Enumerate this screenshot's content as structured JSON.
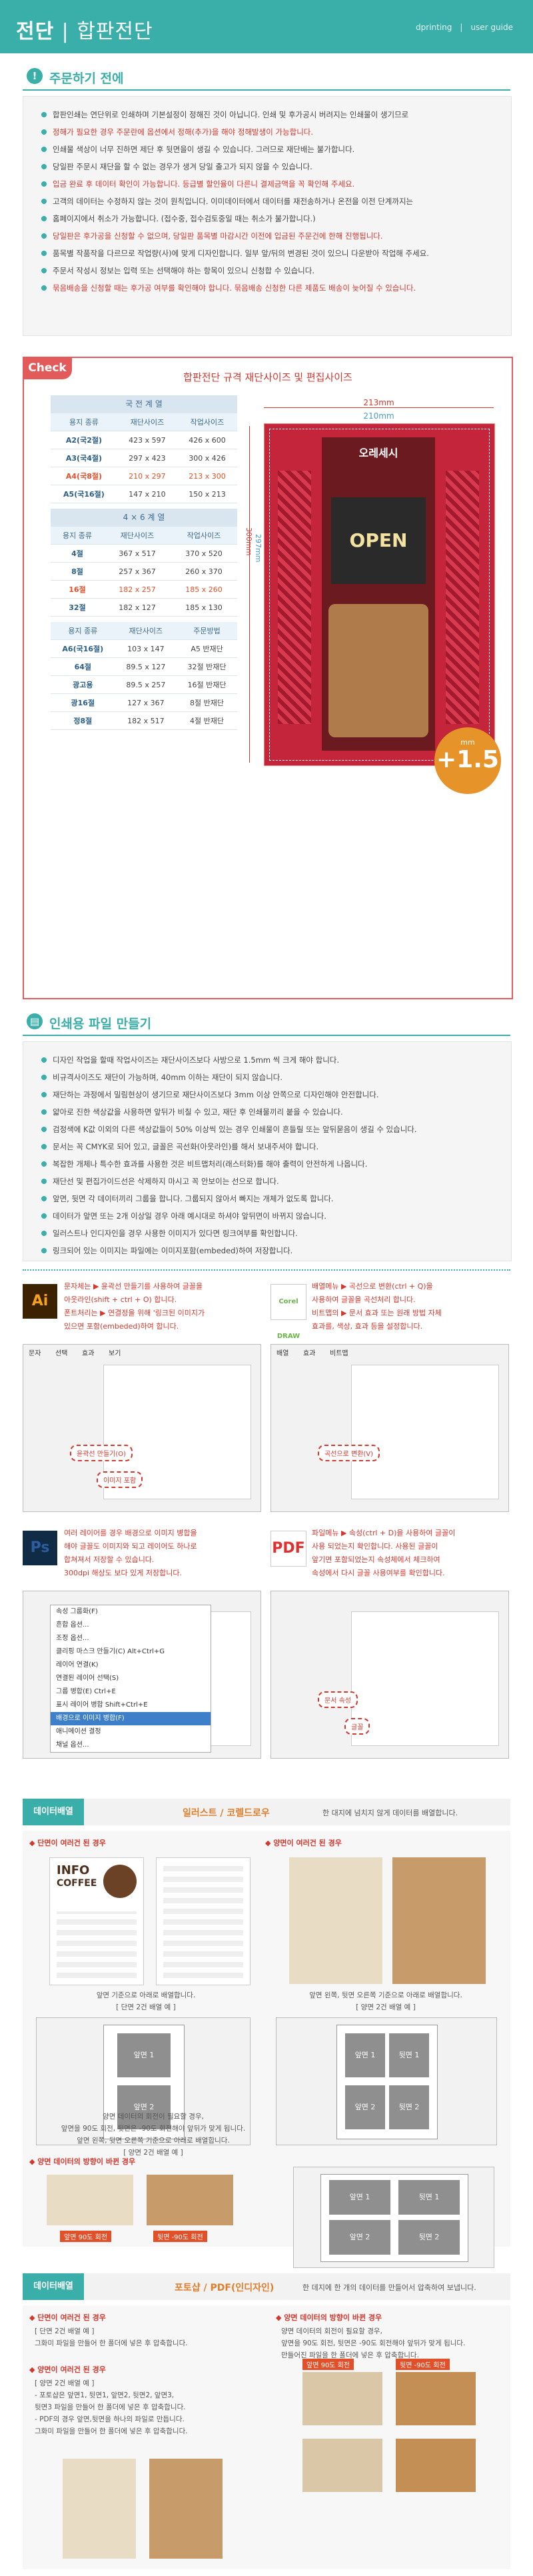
{
  "header": {
    "title_main": "전단",
    "title_sep": "|",
    "title_sub": "합판전단",
    "nav": [
      "dprinting",
      "user guide"
    ]
  },
  "section1": {
    "title": "주문하기 전에",
    "items": [
      {
        "text": "합판인쇄는 연단위로 인쇄하며 기본설정이 정해진 것이 아닙니다. 인쇄 및 후가공시 버려지는 인쇄물이 생기므로",
        "red": false
      },
      {
        "text": "정해가 필요한 경우 주문란에 옵션에서 정해(추가)을 해야 정해발생이 가능합니다.",
        "red": true
      },
      {
        "text": "인쇄물 색상이 너무 진하면 제단 후 뒷면을이 생길 수 있습니다. 그러므로 재단배는 불가합니다.",
        "red": false
      },
      {
        "text": "당일판 주문시 재단을 할 수 없는 경우가 생겨 당일 출고가 되지 않을 수 있습니다.",
        "red": false
      },
      {
        "text": "입금 완료 후 데이터 확인이 가능합니다. 등급별 할인율이 다른니 결제금액을 꼭 확인해 주세요.",
        "red": true
      },
      {
        "text": "고객의 데이터는 수정하지 않는 것이 원칙입니다. 이미데이터에서 데이터를 재전송하거나 온전을 이전 단계까지는",
        "red": false
      },
      {
        "text": "홈페이지에서 취소가 가능합니다. (접수중, 접수검토중일 때는 취소가 불가합니다.)",
        "red": false
      },
      {
        "text": "당일판은 후가공을 신청할 수 없으며, 당일판 품목별 마감시간 이전에 입금된 주문건에 한해 진행됩니다.",
        "red": true
      },
      {
        "text": "품목별 작품작을 다르므로 작업량(사)에 맞게 디자인합니다. 일부 앞/뒤의 변경된 것이 있으니 다운받아 작업해 주세요.",
        "red": false
      },
      {
        "text": "주문서 작성시 정보는 입력 또는 선택해야 하는 항목이 있으니 신청합 수 있습니다.",
        "red": false
      },
      {
        "text": "묶음배송을 신청할 때는 후가공 여부를 확인해야 합니다. 묶음배송 신청한 다른 제품도 배송이 늦어질 수 있습니다.",
        "red": true
      }
    ]
  },
  "section2": {
    "tab": "Check",
    "title": "합판전단 규격 재단사이즈 및 편집사이즈",
    "tables": [
      {
        "caption": "국 전 계 열",
        "headers": [
          "용지 종류",
          "재단사이즈",
          "작업사이즈"
        ],
        "highlight": 2,
        "rows": [
          [
            "A2(국2절)",
            "423 x 597",
            "426 x 600"
          ],
          [
            "A3(국4절)",
            "297 x 423",
            "300 x 426"
          ],
          [
            "A4(국8절)",
            "210 x 297",
            "213 x 300"
          ],
          [
            "A5(국16절)",
            "147 x 210",
            "150 x 213"
          ]
        ]
      },
      {
        "caption": "4 × 6 계 열",
        "headers": [
          "용지 종류",
          "재단사이즈",
          "작업사이즈"
        ],
        "highlight": 2,
        "rows": [
          [
            "4절",
            "367 x 517",
            "370 x 520"
          ],
          [
            "8절",
            "257 x 367",
            "260 x 370"
          ],
          [
            "16절",
            "182 x 257",
            "185 x 260"
          ],
          [
            "32절",
            "182 x 127",
            "185 x 130"
          ]
        ]
      },
      {
        "caption": "",
        "headers": [
          "용지 종류",
          "재단사이즈",
          "주문방법"
        ],
        "highlight": -1,
        "rows": [
          [
            "A6(국16절)",
            "103 x 147",
            "A5 반재단"
          ],
          [
            "64절",
            "89.5 x 127",
            "32절 반재단"
          ],
          [
            "광고용",
            "89.5 x 257",
            "16절 반재단"
          ],
          [
            "광16절",
            "127 x 367",
            "8절 반재단"
          ],
          [
            "정8절",
            "182 x 517",
            "4절 반재단"
          ]
        ]
      }
    ],
    "diagram": {
      "outer_w": "213mm",
      "inner_w": "210mm",
      "outer_h": "300mm",
      "inner_h": "297mm",
      "bleed_label": "+1.5",
      "bleed_unit": "mm",
      "brand": "오레세시",
      "open": "OPEN"
    }
  },
  "section3": {
    "title": "인쇄용 파일 만들기",
    "items": [
      {
        "text": "디자인 작업을 할때 작업사이즈는 재단사이즈보다 사방으로 1.5mm 씩 크게 해야 합니다.",
        "red": false
      },
      {
        "text": "비규격사이즈도 재단이 가능하며, 40mm 이하는 재단이 되지 않습니다.",
        "red": false
      },
      {
        "text": "재단하는 과정에서 밀림현상이 생기므로 재단사이즈보다 3mm 이상 안쪽으로 디자인해야 안전합니다.",
        "red": false
      },
      {
        "text": "얇아로 진한 색상값을 사용하면 앞뒤가 비칠 수 있고, 재단 후 인쇄물끼리 붙을 수 있습니다.",
        "red": false
      },
      {
        "text": "검정색에 K값 이외의 다른 색상값들이 50% 이상씩 있는 경우 인쇄물이 흔들릴 또는 앞뒤묻음이 생길 수 있습니다.",
        "red": false
      },
      {
        "text": "문서는 꼭 CMYK로 되어 있고, 글꼴은 곡선화(아웃라인)를 해서 보내주셔야 합니다.",
        "red": false
      },
      {
        "text": "복잡한 개체나 특수한 효과를 사용한 것은 비트맵처리(래스터화)를 해야 출력이 안전하게 나옵니다.",
        "red": false
      },
      {
        "text": "재단선 및 편집가이드선은 삭제하지 마시고 꼭 안보이는 선으로 합니다.",
        "red": false
      },
      {
        "text": "앞면, 뒷면 각 데이터끼리 그룹을 합니다. 그룹되지 않아서 빠지는 개체가 없도록 합니다.",
        "red": false
      },
      {
        "text": "데이터가 앞면 또는 2개 이상일 경우 아래 예시대로 하셔야 앞뒤면이 바뀌지 않습니다.",
        "red": false
      },
      {
        "text": "일러스트나 인디자인을 경우 사용한 이미지가 있다면 링크여부를 확인합니다.",
        "red": false
      },
      {
        "text": "링크되어 있는 이미지는 파일에는 이미지포함(embeded)하여 저장합니다.",
        "red": false
      }
    ]
  },
  "apps": [
    {
      "icon": "Ai",
      "notes": [
        "문자체는 ▶ 윤곽선 만들기를 사용하여 글꼴을",
        "아웃라인(shift + ctrl + O) 합니다.",
        "폰트처리는 ▶ 연결정을 위해 '링크된 이미지가",
        "있으면 포함(embeded)하여 합니다."
      ],
      "callouts": [
        "윤곽선 만들기(O)",
        "이미지 포함"
      ],
      "menu": [
        "문자",
        "선택",
        "효과",
        "보기"
      ]
    },
    {
      "icon": "Corel DRAW",
      "notes": [
        "배열메뉴 ▶ 곡선으로 변환(ctrl + Q)을",
        "사용하여 글꼴을 곡선처리 합니다.",
        "비트맵의 ▶ 문서 효과 또는 원래 방법 자체",
        "효과를, 색상, 효과 등을 설정합니다."
      ],
      "callouts": [
        "곡선으로 변환(V)"
      ],
      "menu": [
        "배열",
        "효과",
        "비트맵"
      ]
    },
    {
      "icon": "Ps",
      "notes": [
        "여러 레이어를 경우 배경으로 이미지 병합을",
        "해야 글꼴도 이미지와 되고 레이어도 하나로",
        "합쳐져서 저장할 수 있습니다.",
        "300dpi 해상도 보다 있게 저장합니다."
      ],
      "menu_items": [
        "속성 그룹화(F)",
        "흔합 옵션...",
        "조정 옵션...",
        "클리핑 마스크 만들기(C)   Alt+Ctrl+G",
        "레이어 연결(K)",
        "연결된 레이어 선택(S)",
        "그룹 병합(E)   Ctrl+E",
        "표시 레이어 병합   Shift+Ctrl+E",
        "배경으로 이미지 병합(F)",
        "애니메이션 결정",
        "채널 옵션..."
      ],
      "highlight": "배경으로 이미지 병합(F)"
    },
    {
      "icon": "PDF",
      "notes": [
        "파일메뉴 ▶ 속성(ctrl + D)을 사용하여 글꼴이",
        "사용 되었는지 확인합니다. 사용된 글꼴이",
        "앞기면 포함되었는지 속성체에서 체크하여",
        "속성에서 다시 글꼴 사용여부를 확인합니다."
      ],
      "callouts": [
        "문서 속성",
        "글꼴"
      ]
    }
  ],
  "layout1": {
    "tag": "데이터배열",
    "title": "일러스트 / 코렐드로우",
    "desc": "한 대지에 넘치지 않게 데이터를 배열합니다.",
    "left_label": "◆ 단면이 여러건 된 경우",
    "right_label": "◆ 양면이 여러건 된 경우",
    "left_caption": [
      "앞면 기준으로 아래로 배열합니다.",
      "[ 단면 2건 배열 예 ]"
    ],
    "right_caption": [
      "앞면 왼쪽, 뒷면 오른쪽 기준으로 아래로 배열합니다.",
      "[ 양면 2건 배열 예 ]"
    ],
    "doc_text": [
      "INFO",
      "COFFEE"
    ],
    "slots_left": [
      "앞면 1",
      "앞면 2"
    ],
    "slots_right": [
      "앞면 1",
      "뒷면 1",
      "앞면 2",
      "뒷면 2"
    ],
    "rot_label": "◆ 양면 데이터의 방향이 바뀐 경우",
    "rot_desc": [
      "양면 데이터의 회전이 필요할 경우,",
      "앞면을 90도 회전, 뒷면은 -90도 회전해야 앞뒤가 맞게 됩니다.",
      "앞면 왼쪽, 뒷면 오른쪽 기준으로 아래로 배열합니다.",
      "[ 양면 2건 배열 예 ]"
    ],
    "rot_tags": [
      "앞면 90도 회전",
      "뒷면 -90도 회전"
    ],
    "rot_slots": [
      "앞면 1",
      "뒷면 1",
      "앞면 2",
      "뒷면 2"
    ]
  },
  "layout2": {
    "tag": "데이터배열",
    "title": "포토샵 / PDF(인디자인)",
    "desc": "한 데지에 한 개의 데이터를 만들어서 압축하여 보냅니다.",
    "a_label": "◆ 단면이 여러건 된 경우",
    "a_lines": [
      "[ 단면 2건 배열 예 ]",
      "그화미 파일을 만들어 한 폴더에 넣은 후 압축합니다."
    ],
    "b_label": "◆ 양면이 여러건 된 경우",
    "b_lines": [
      "[ 양면 2건 배열 예 ]",
      "- 포토샵은 앞면1, 뒷면1, 앞면2, 뒷면2, 앞면3,",
      "  뒷면3 파일을 만들어 한 폴더에 넣은 후 압축합니다.",
      "- PDF의 경우 앞면,뒷면을 하나의 파일로 만듭니다.",
      "  그화미 파일을 만들어 한 폴더에 넣은 후 압축합니다."
    ],
    "c_label": "◆ 양면 데이터의 방향이 바뀐 경우",
    "c_lines": [
      "양면 데이터의 회전이 필요할 경우,",
      "앞면을 90도 회전, 뒷면은 -90도 회전해야 앞뒤가 맞게 됩니다.",
      "만들어진 파일을 한 폴더에 넣은 후 압축합니다."
    ],
    "c_tags": [
      "앞면 90도 회전",
      "뒷면 -90도 회전"
    ]
  },
  "colors": {
    "accent": "#3aaea8",
    "red": "#d4372d",
    "check": "#e35a5a"
  }
}
